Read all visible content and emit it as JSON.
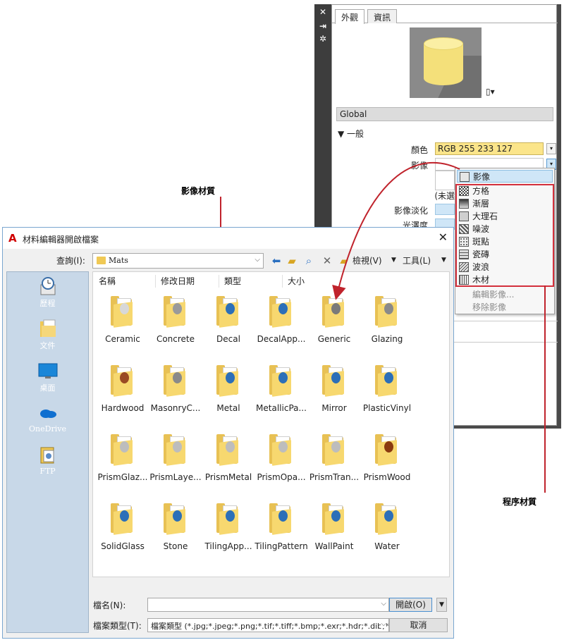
{
  "callouts": {
    "image_material": "影像材質",
    "procedural_material": "程序材質"
  },
  "material_editor": {
    "tabs": [
      "外觀",
      "資訊"
    ],
    "material_name": "Global",
    "section_general": "▼ 一般",
    "labels": {
      "color": "顏色",
      "image": "影像",
      "unselected": "(未選",
      "image_fade": "影像淡化",
      "glossiness": "光澤度"
    },
    "color_value": "RGB 255 233 127",
    "colors": {
      "preview_bg": "#8a8a8a",
      "cylinder": "#f4e07a",
      "color_field": "#fbe58a"
    }
  },
  "image_menu": {
    "items": [
      "影像",
      "方格",
      "漸層",
      "大理石",
      "噪波",
      "斑點",
      "瓷磚",
      "波浪",
      "木材"
    ],
    "disabled_items": [
      "編輯影像...",
      "移除影像"
    ]
  },
  "dialog": {
    "title": "材料編輯器開啟檔案",
    "lookin_label": "查詢(I):",
    "lookin_value": "Mats",
    "views_label": "檢視(V)",
    "tools_label": "工具(L)",
    "places": [
      "歷程",
      "文件",
      "桌面",
      "OneDrive",
      "FTP"
    ],
    "columns": [
      "名稱",
      "修改日期",
      "類型",
      "大小"
    ],
    "files": [
      "Ceramic",
      "Concrete",
      "Decal",
      "DecalApp...",
      "Generic",
      "Glazing",
      "Hardwood",
      "MasonryC...",
      "Metal",
      "MetallicPa...",
      "Mirror",
      "PlasticVinyl",
      "PrismGlaz...",
      "PrismLaye...",
      "PrismMetal",
      "PrismOpa...",
      "PrismTran...",
      "PrismWood",
      "SolidGlass",
      "Stone",
      "TilingApp...",
      "TilingPattern",
      "WallPaint",
      "Water"
    ],
    "filename_label": "檔名(N):",
    "filename_value": "",
    "filetype_label": "檔案類型(T):",
    "filetype_value": "檔案類型 (*.jpg;*.jpeg;*.png;*.tif;*.tiff;*.bmp;*.exr;*.hdr;*.dib;*",
    "open_button": "開啟(O)",
    "cancel_button": "取消"
  }
}
